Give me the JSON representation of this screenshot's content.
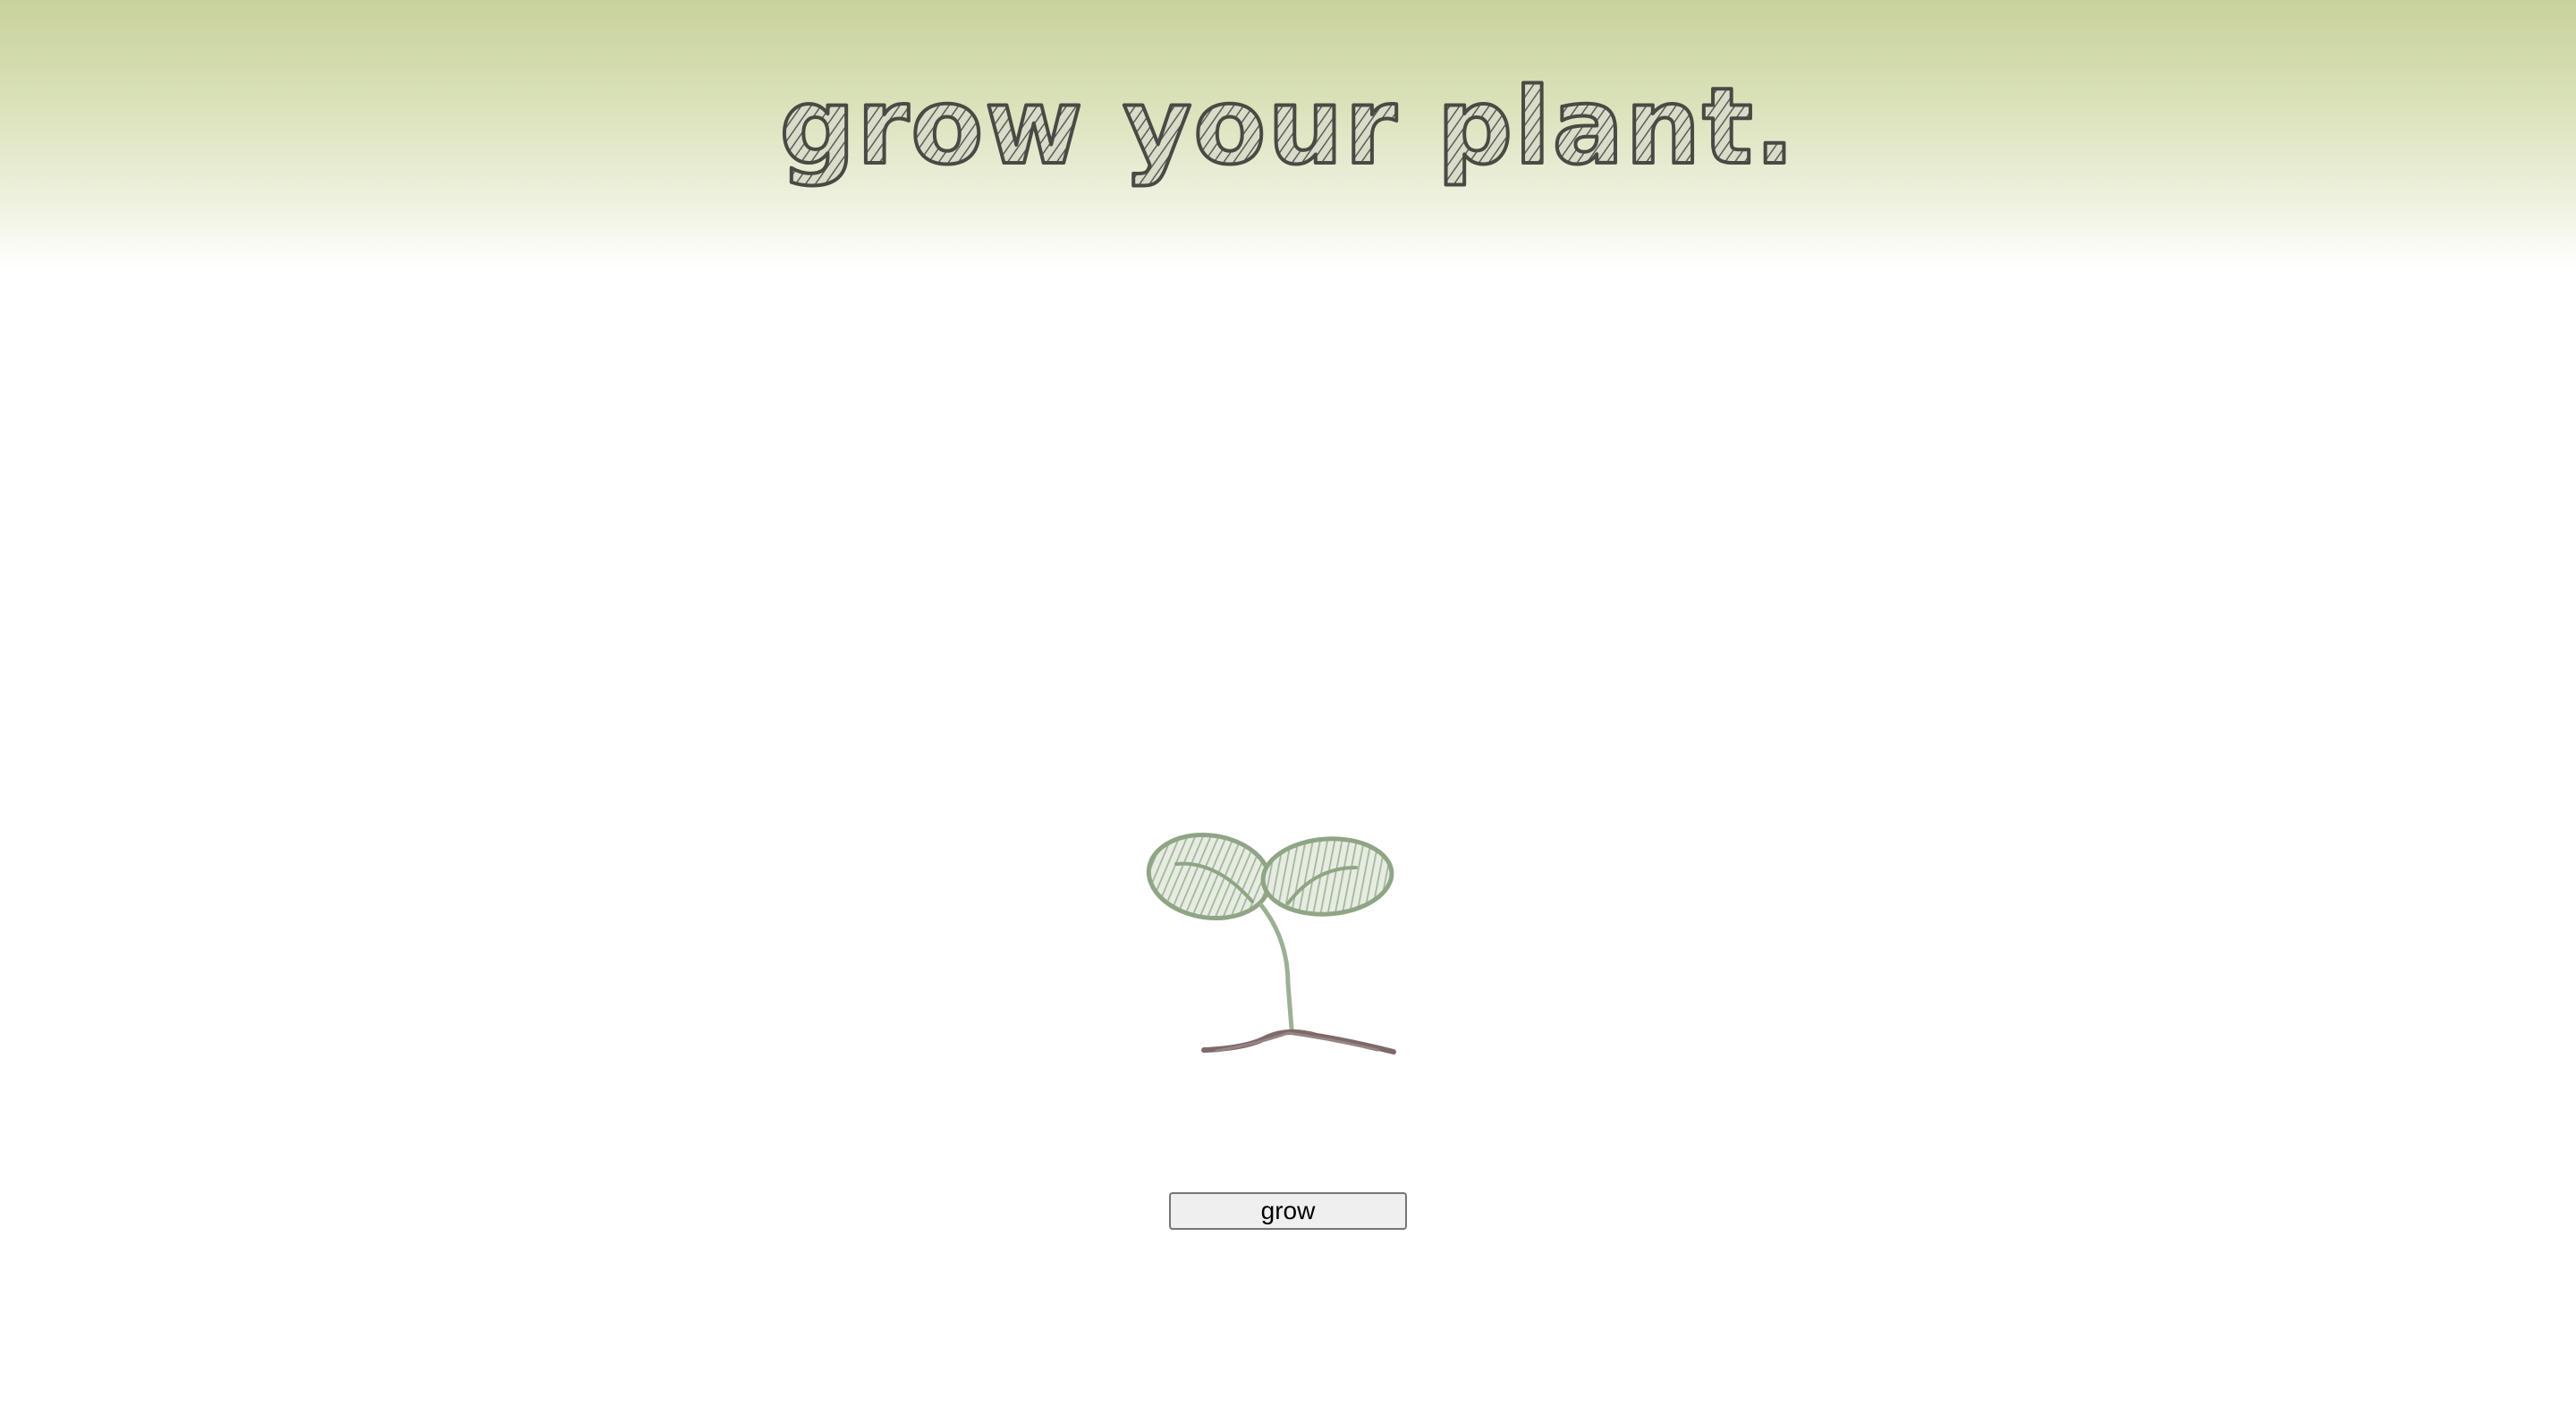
{
  "page": {
    "title": "grow your plant.",
    "title_color": "#4a4a44",
    "header_gradient_top": "#c8d29b"
  },
  "plant": {
    "leaf_color": "#8fa585",
    "stem_color": "#9cb094",
    "soil_color": "#7d6a68"
  },
  "controls": {
    "grow_label": "grow"
  }
}
